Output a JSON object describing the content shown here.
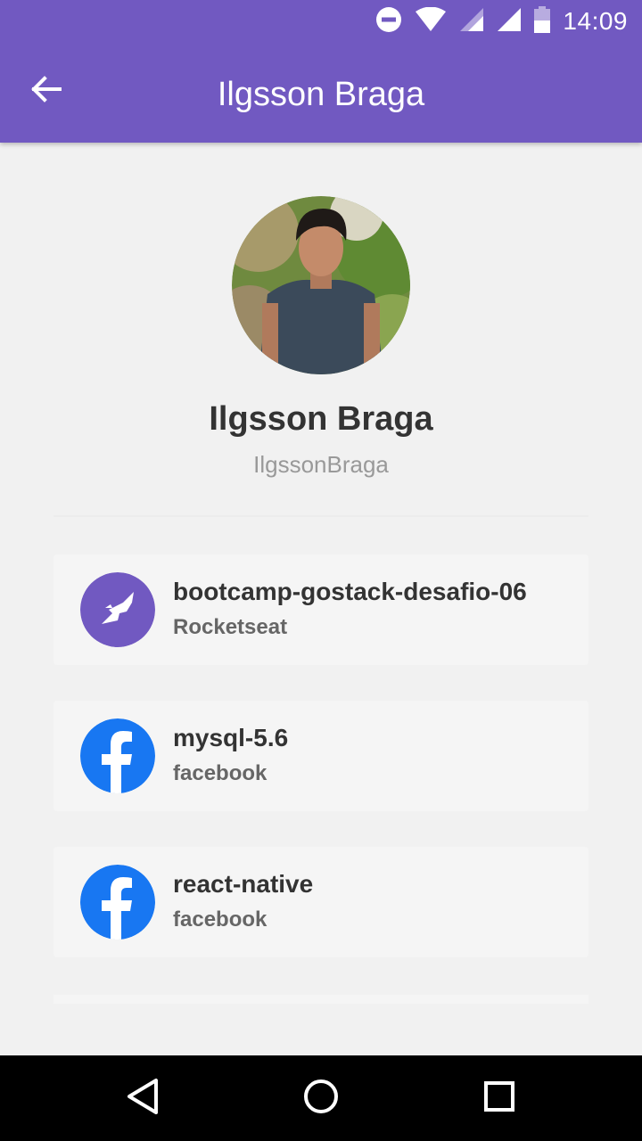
{
  "status_bar": {
    "time": "14:09",
    "icons": [
      "do-not-disturb-icon",
      "wifi-icon",
      "signal-icon",
      "signal-icon",
      "battery-icon"
    ]
  },
  "app_bar": {
    "title": "Ilgsson Braga",
    "back_icon": "arrow-left-icon",
    "background_color": "#7159c1"
  },
  "profile": {
    "name": "Ilgsson Braga",
    "login": "IlgssonBraga"
  },
  "repositories": [
    {
      "name": "bootcamp-gostack-desafio-06",
      "owner": "Rocketseat",
      "owner_icon": "rocketseat-logo-icon"
    },
    {
      "name": "mysql-5.6",
      "owner": "facebook",
      "owner_icon": "facebook-logo-icon"
    },
    {
      "name": "react-native",
      "owner": "facebook",
      "owner_icon": "facebook-logo-icon"
    }
  ],
  "nav_bar": {
    "icons": [
      "back-triangle-icon",
      "home-circle-icon",
      "recents-square-icon"
    ]
  },
  "colors": {
    "accent": "#7159c1",
    "facebook": "#1877f2",
    "background": "#f1f1f1"
  }
}
